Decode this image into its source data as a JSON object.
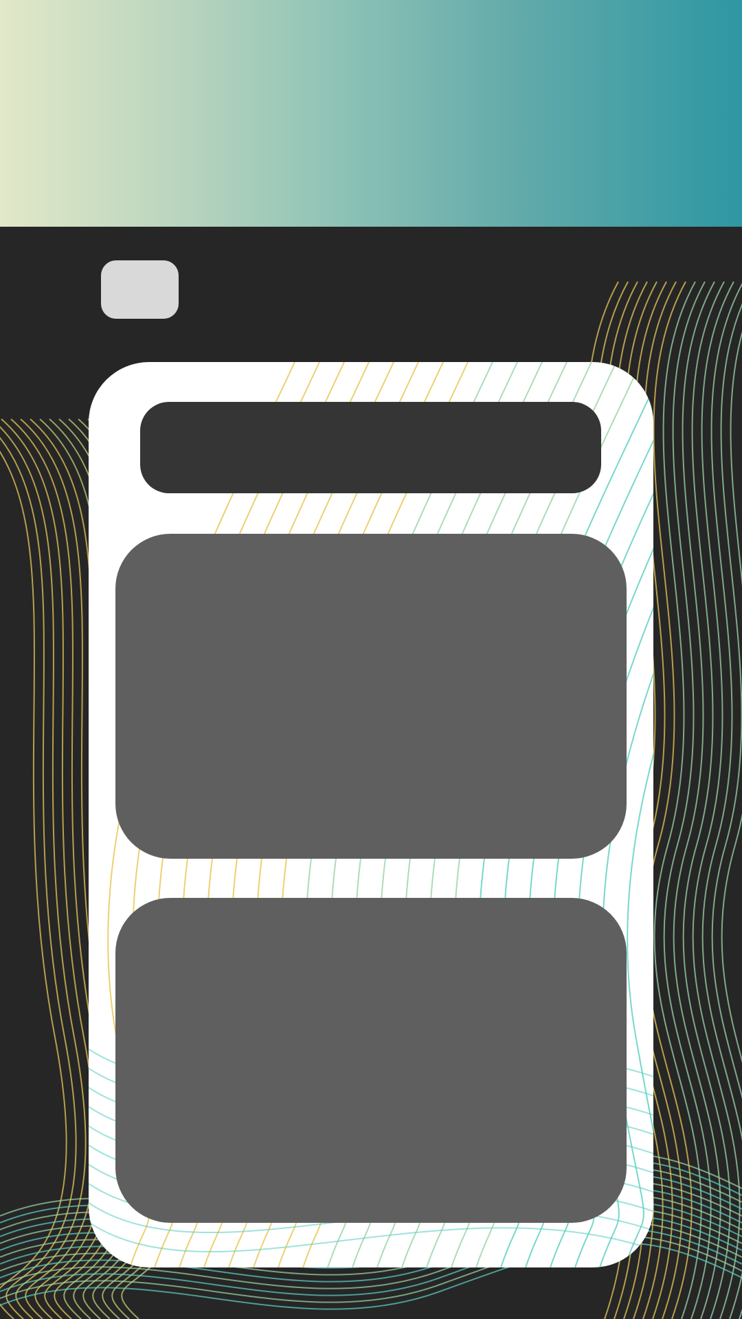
{
  "theme": {
    "background": "#262626",
    "banner_gradient": [
      "#e2e8c8",
      "#b8d4be",
      "#8fc3b6",
      "#62aaaa",
      "#2e97a3"
    ],
    "card": "#ffffff",
    "title_bar": "#353535",
    "panel": "#5f5f5f",
    "button": "#d9d9d9",
    "wave_colors": [
      "#e9c85a",
      "#9fd6a8",
      "#5fd0c3",
      "#c5cf77"
    ]
  },
  "header": {},
  "back_button": {
    "icon": "back-icon"
  },
  "card": {
    "title_bar": {},
    "panels": [
      {},
      {}
    ]
  }
}
